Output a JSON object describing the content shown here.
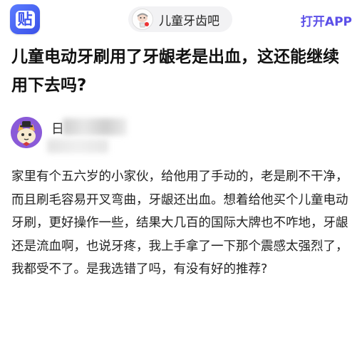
{
  "header": {
    "app_logo_char": "贴",
    "forum_name": "儿童牙齿吧",
    "open_app_label": "打开APP",
    "accent_color": "#5b4fe8"
  },
  "post": {
    "title": "儿童电动牙刷用了牙龈老是出血，这还能继续用下去吗?",
    "author_name_visible": "日",
    "body": "家里有个五六岁的小家伙，给他用了手动的，老是刷不干净，而且刷毛容易开叉弯曲，牙龈还出血。想着给他买个儿童电动牙刷，更好操作一些，结果大几百的国际大牌也不咋地，牙龈还是流血啊，也说牙疼，我上手拿了一下那个震感太强烈了，我都受不了。是我选错了吗，有没有好的推荐?"
  }
}
